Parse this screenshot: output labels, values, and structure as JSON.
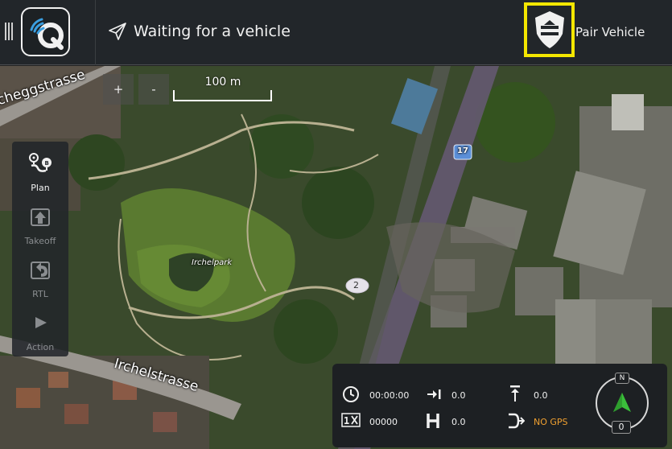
{
  "header": {
    "status_text": "Waiting for a vehicle",
    "pair_label": "Pair Vehicle"
  },
  "map": {
    "zoom_in_label": "+",
    "zoom_out_label": "-",
    "scale_label": "100 m",
    "labels": {
      "street_top": "cheggstrasse",
      "street_bottom": "Irchelstrasse",
      "park": "Irchelpark",
      "route_badge_17": "17",
      "route_badge_2": "2"
    }
  },
  "toolstrip": {
    "items": [
      {
        "label": "Plan",
        "icon": "plan-icon",
        "active": true
      },
      {
        "label": "Takeoff",
        "icon": "takeoff-icon",
        "active": false
      },
      {
        "label": "RTL",
        "icon": "rtl-icon",
        "active": false
      },
      {
        "label": "Action",
        "icon": "action-icon",
        "active": false
      }
    ]
  },
  "instrument": {
    "flight_time": "00:00:00",
    "distance_home": "0.0",
    "altitude_rel": "0.0",
    "counter": "00000",
    "heading_alt": "0.0",
    "gps_status": "NO GPS",
    "compass_n": "N",
    "compass_heading": "0"
  },
  "colors": {
    "highlight": "#f3e600",
    "panel": "#22262a",
    "nogps": "#f0a030",
    "compass_arrow": "#3bbf3b"
  }
}
